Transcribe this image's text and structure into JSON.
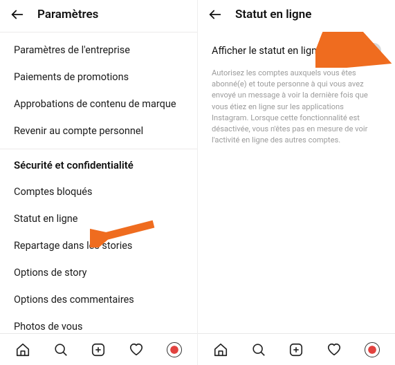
{
  "colors": {
    "accent_arrow": "#ef6c1f"
  },
  "left": {
    "header": {
      "title": "Paramètres"
    },
    "group1": {
      "items": [
        {
          "label": "Paramètres de l'entreprise"
        },
        {
          "label": "Paiements de promotions"
        },
        {
          "label": "Approbations de contenu de marque"
        },
        {
          "label": "Revenir au compte personnel"
        }
      ]
    },
    "section_title": "Sécurité et confidentialité",
    "group2": {
      "items": [
        {
          "label": "Comptes bloqués"
        },
        {
          "label": "Statut en ligne"
        },
        {
          "label": "Repartage dans les stories"
        },
        {
          "label": "Options de story"
        },
        {
          "label": "Options des commentaires"
        },
        {
          "label": "Photos de vous"
        }
      ]
    }
  },
  "right": {
    "header": {
      "title": "Statut en ligne"
    },
    "toggle": {
      "label": "Afficher le statut en ligne",
      "state": "off"
    },
    "helper": "Autorisez les comptes auxquels vous êtes abonné(e) et toute personne à qui vous avez envoyé un message à voir la dernière fois que vous étiez en ligne sur les applications Instagram. Lorsque cette fonctionnalité est désactivée, vous n'êtes pas en mesure de voir l'activité en ligne des autres comptes."
  },
  "nav": {
    "home": "home-icon",
    "search": "search-icon",
    "create": "create-icon",
    "activity": "heart-icon",
    "profile": "profile-avatar"
  }
}
